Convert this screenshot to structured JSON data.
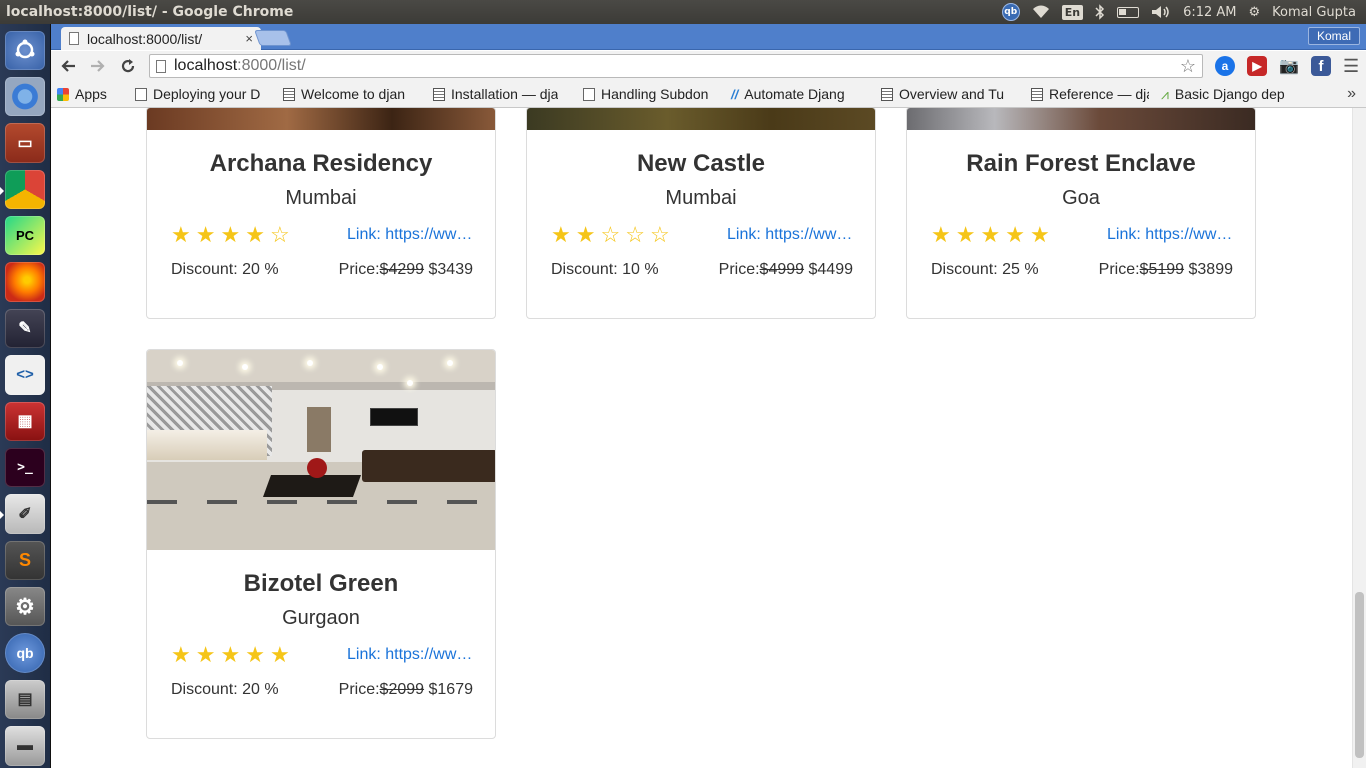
{
  "system": {
    "window_title": "localhost:8000/list/ - Google Chrome",
    "lang_indicator": "En",
    "qb_indicator": "qb",
    "time": "6:12 AM",
    "user": "Komal Gupta"
  },
  "launcher": {
    "items": [
      "dash-home",
      "chromium",
      "files",
      "chrome",
      "pycharm",
      "firefox",
      "inkscape",
      "code-editor",
      "red-app",
      "terminal",
      "text-editor",
      "sublime-text",
      "system-settings",
      "qbittorrent",
      "scanner",
      "drive"
    ]
  },
  "browser": {
    "tab_title": "localhost:8000/list/",
    "tab_close": "×",
    "profile_name": "Komal",
    "url_host": "localhost",
    "url_path": ":8000/list/",
    "bookmarks": [
      {
        "label": "Apps",
        "icon": "apps-grid-icon"
      },
      {
        "label": "Deploying your D",
        "icon": "page-icon"
      },
      {
        "label": "Welcome to djan",
        "icon": "doc-icon"
      },
      {
        "label": "Installation — dja",
        "icon": "doc-icon"
      },
      {
        "label": "Handling Subdon",
        "icon": "page-icon"
      },
      {
        "label": "Automate Djang",
        "icon": "slash-icon"
      },
      {
        "label": "Overview and Tu",
        "icon": "doc-icon"
      },
      {
        "label": "Reference — djar",
        "icon": "doc-icon"
      },
      {
        "label": "Basic Django dep",
        "icon": "chart-icon"
      }
    ],
    "bookmarks_more": "»"
  },
  "hotels": [
    {
      "name": "Archana Residency",
      "city": "Mumbai",
      "rating": 4,
      "link": "Link: https://www.archanaresidency.com",
      "discount": "Discount: 20 %",
      "price_label": "Price:",
      "old_price": "$4299",
      "new_price": "$3439"
    },
    {
      "name": "New Castle",
      "city": "Mumbai",
      "rating": 2,
      "link": "Link: https://www.newcastle.com",
      "discount": "Discount: 10 %",
      "price_label": "Price:",
      "old_price": "$4999",
      "new_price": "$4499"
    },
    {
      "name": "Rain Forest Enclave",
      "city": "Goa",
      "rating": 5,
      "link": "Link: https://www.rainforestenclave.com",
      "discount": "Discount: 25 %",
      "price_label": "Price:",
      "old_price": "$5199",
      "new_price": "$3899"
    },
    {
      "name": "Bizotel Green",
      "city": "Gurgaon",
      "rating": 5,
      "link": "Link: https://www.bizotelgreen.com",
      "discount": "Discount: 20 %",
      "price_label": "Price:",
      "old_price": "$2099",
      "new_price": "$1679"
    }
  ],
  "colors": {
    "star": "#f5c518",
    "link": "#1a73d9",
    "tabstrip": "#4f7fcb",
    "ubuntu_panel": "#3c3b37"
  }
}
